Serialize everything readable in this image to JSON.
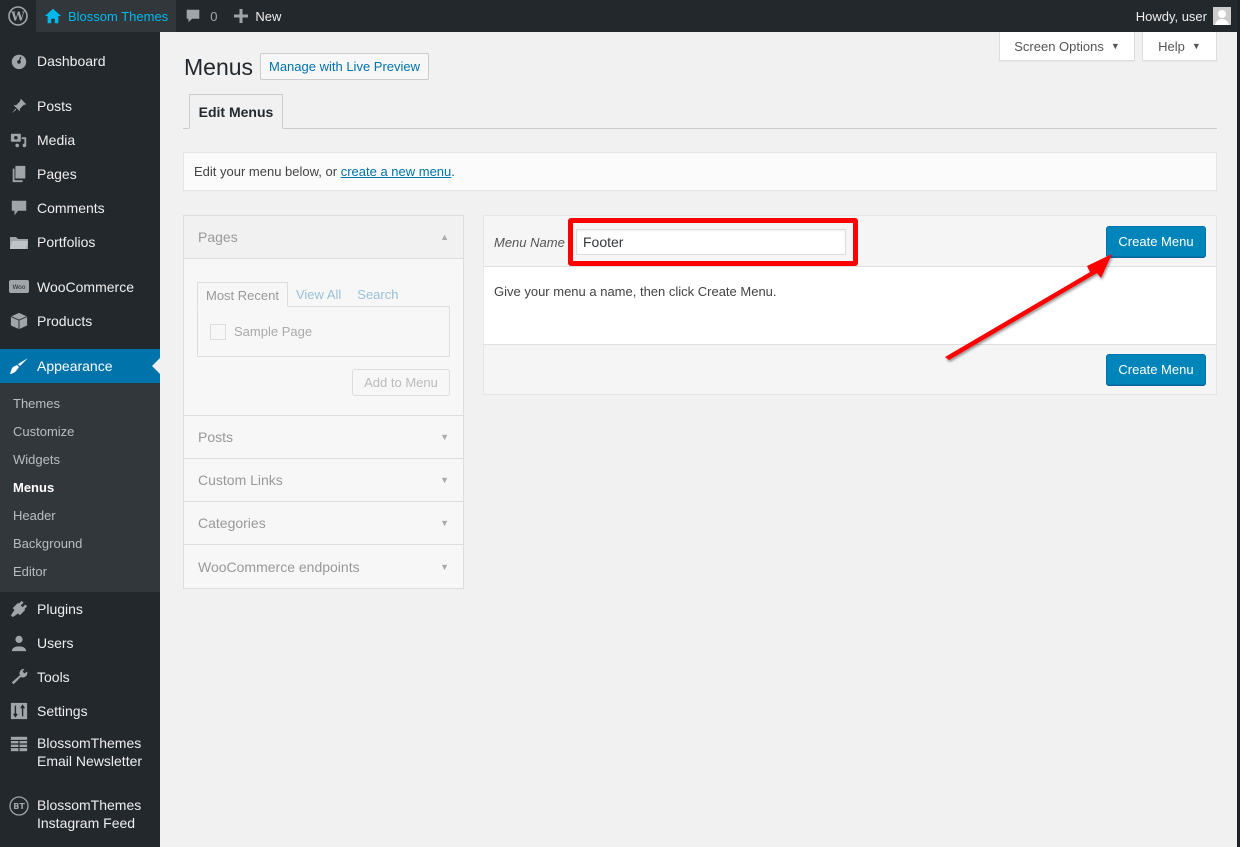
{
  "adminbar": {
    "site_name": "Blossom Themes",
    "comments_count": "0",
    "new_label": "New",
    "howdy": "Howdy, user"
  },
  "sidebar": {
    "items": [
      {
        "label": "Dashboard",
        "icon": "dashboard-icon"
      },
      {
        "label": "Posts",
        "icon": "pin-icon"
      },
      {
        "label": "Media",
        "icon": "media-icon"
      },
      {
        "label": "Pages",
        "icon": "pages-icon"
      },
      {
        "label": "Comments",
        "icon": "comment-icon"
      },
      {
        "label": "Portfolios",
        "icon": "folder-icon"
      },
      {
        "label": "WooCommerce",
        "icon": "woo-icon"
      },
      {
        "label": "Products",
        "icon": "box-icon"
      },
      {
        "label": "Appearance",
        "icon": "brush-icon"
      },
      {
        "label": "Plugins",
        "icon": "plug-icon"
      },
      {
        "label": "Users",
        "icon": "user-icon"
      },
      {
        "label": "Tools",
        "icon": "wrench-icon"
      },
      {
        "label": "Settings",
        "icon": "sliders-icon"
      },
      {
        "label": "BlossomThemes Email Newsletter",
        "icon": "table-icon"
      },
      {
        "label": "BlossomThemes Instagram Feed",
        "icon": "bt-icon"
      }
    ],
    "appearance_sub": [
      "Themes",
      "Customize",
      "Widgets",
      "Menus",
      "Header",
      "Background",
      "Editor"
    ]
  },
  "header": {
    "title": "Menus",
    "live_preview": "Manage with Live Preview",
    "screen_options": "Screen Options",
    "help": "Help",
    "tab": "Edit Menus"
  },
  "notice": {
    "text": "Edit your menu below, or ",
    "link": "create a new menu",
    "suffix": "."
  },
  "accordion": {
    "pages": {
      "title": "Pages",
      "tabs": [
        "Most Recent",
        "View All",
        "Search"
      ],
      "item": "Sample Page",
      "add_button": "Add to Menu"
    },
    "sections": [
      "Posts",
      "Custom Links",
      "Categories",
      "WooCommerce endpoints"
    ]
  },
  "menu_edit": {
    "name_label": "Menu Name",
    "name_value": "Footer",
    "create_button": "Create Menu",
    "instructions": "Give your menu a name, then click Create Menu."
  },
  "annotation": {
    "highlight_color": "#ff0000"
  }
}
